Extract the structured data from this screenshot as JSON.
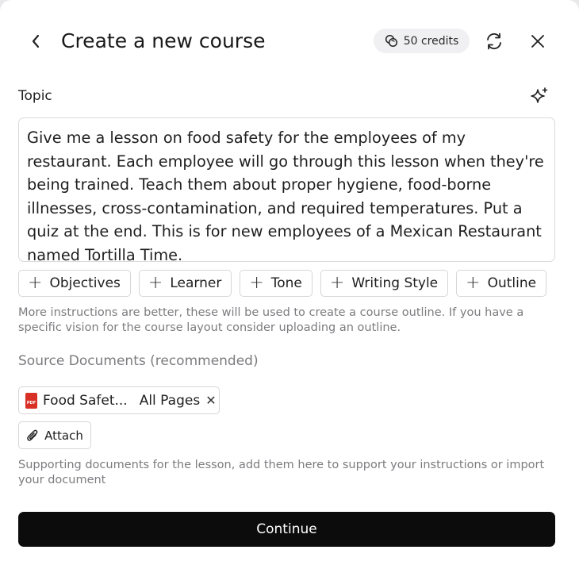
{
  "header": {
    "title": "Create a new course",
    "credits_label": "50 credits",
    "icons": {
      "back": "chevron-left-icon",
      "credits": "coins-icon",
      "refresh": "refresh-icon",
      "close": "close-icon",
      "sparkle": "sparkle-icon"
    }
  },
  "topic": {
    "label": "Topic",
    "value": "Give me a lesson on food safety for the employees of my restaurant. Each employee will go through this lesson when they're being trained. Teach them about proper hygiene, food-borne illnesses, cross-contamination, and required temperatures. Put a quiz at the end. This is for new employees of a Mexican Restaurant named Tortilla Time."
  },
  "chips": [
    {
      "label": "Objectives"
    },
    {
      "label": "Learner"
    },
    {
      "label": "Tone"
    },
    {
      "label": "Writing Style"
    },
    {
      "label": "Outline"
    }
  ],
  "instructions_hint": "More instructions are better, these will be used to create a course outline. If you have a specific vision for the course layout consider uploading an outline.",
  "sources": {
    "label": "Source Documents (recommended)",
    "documents": [
      {
        "name": "Food Safet...",
        "pages": "All Pages",
        "icon": "pdf-file-icon"
      }
    ],
    "attach_label": "Attach",
    "hint": "Supporting documents for the lesson, add them here to support your instructions or import your document"
  },
  "continue_label": "Continue",
  "colors": {
    "primary_button": "#0c0c0d",
    "pdf_red": "#d93025",
    "muted_text": "#7c7c80"
  }
}
